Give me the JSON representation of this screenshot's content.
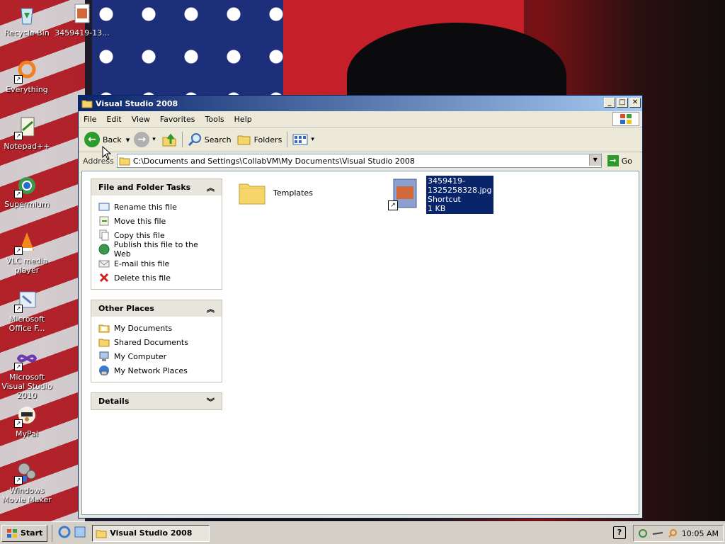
{
  "desktop": {
    "icons": [
      {
        "label": "Recycle Bin",
        "icon": "recycle-bin-icon"
      },
      {
        "label": "3459419-13...",
        "icon": "image-file-icon"
      },
      {
        "label": "Everything",
        "icon": "everything-icon"
      },
      {
        "label": "Notepad++",
        "icon": "notepadpp-icon"
      },
      {
        "label": "Supermium",
        "icon": "supermium-icon"
      },
      {
        "label": "VLC media player",
        "icon": "vlc-icon"
      },
      {
        "label": "Microsoft Office F...",
        "icon": "office-icon"
      },
      {
        "label": "Microsoft Visual Studio 2010",
        "icon": "visual-studio-icon"
      },
      {
        "label": "MyPal",
        "icon": "mypal-icon"
      },
      {
        "label": "Windows Movie Maker",
        "icon": "movie-maker-icon"
      }
    ]
  },
  "window": {
    "title": "Visual Studio 2008",
    "menu": [
      "File",
      "Edit",
      "View",
      "Favorites",
      "Tools",
      "Help"
    ],
    "toolbar": {
      "back_label": "Back",
      "search_label": "Search",
      "folders_label": "Folders"
    },
    "address": {
      "label": "Address",
      "value": "C:\\Documents and Settings\\CollabVM\\My Documents\\Visual Studio 2008",
      "go_label": "Go"
    },
    "tasks_panel": {
      "title": "File and Folder Tasks",
      "items": [
        {
          "label": "Rename this file",
          "icon": "rename-icon"
        },
        {
          "label": "Move this file",
          "icon": "move-icon"
        },
        {
          "label": "Copy this file",
          "icon": "copy-icon"
        },
        {
          "label": "Publish this file to the Web",
          "icon": "publish-web-icon"
        },
        {
          "label": "E-mail this file",
          "icon": "email-icon"
        },
        {
          "label": "Delete this file",
          "icon": "delete-icon"
        }
      ]
    },
    "other_places": {
      "title": "Other Places",
      "items": [
        {
          "label": "My Documents",
          "icon": "my-documents-icon"
        },
        {
          "label": "Shared Documents",
          "icon": "shared-documents-icon"
        },
        {
          "label": "My Computer",
          "icon": "my-computer-icon"
        },
        {
          "label": "My Network Places",
          "icon": "network-places-icon"
        }
      ]
    },
    "details": {
      "title": "Details"
    },
    "files": [
      {
        "name": "Templates",
        "type": "folder"
      },
      {
        "name": "3459419-1325258328.jpg",
        "line2": "Shortcut",
        "line3": "1 KB",
        "type": "shortcut",
        "selected": true
      }
    ]
  },
  "taskbar": {
    "start_label": "Start",
    "task_label": "Visual Studio 2008",
    "clock": "10:05 AM"
  },
  "colors": {
    "titlebar_start": "#0a246a",
    "titlebar_end": "#a6caf0",
    "selection": "#0a246a",
    "window_bg": "#ece9d8"
  }
}
